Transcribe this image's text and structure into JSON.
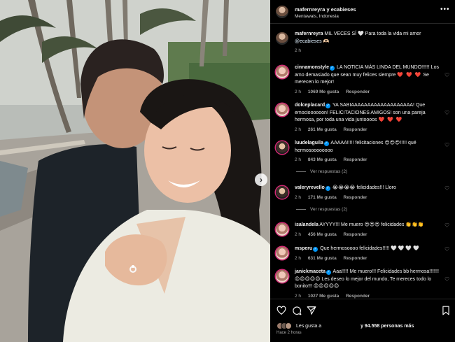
{
  "header": {
    "usernames": "mafernreyra y ecabieses",
    "location": "Mentawais, Indonesia",
    "more_icon": "more-horizontal-icon"
  },
  "caption": {
    "user": "mafernreyra",
    "text_pre": "MIL VECES SÍ 🤍 Para toda la vida mi amor",
    "mention": "@ecabieses",
    "text_post": "🫶🏻",
    "time": "2 h"
  },
  "comments": [
    {
      "user": "cinnamonstyle",
      "verified": true,
      "text": "LA NOTICIA MÁS LINDA DEL MUNDO!!!!!! Los amo demasiado que sean muy felices siempre",
      "hearts": "❤️ ❤️ ❤️",
      "text_after": "Se merecen lo mejor!",
      "time": "2 h",
      "likes": "1069 Me gusta",
      "reply": "Responder"
    },
    {
      "user": "dolceplacard",
      "verified": true,
      "text": "YA SABIAAAAAAAAAAAAAAAAAAA! Que emocioooooon! FELICITACIONES AMIGOS! son una pareja hermosa, por toda una vida juntoooos",
      "hearts": "❤️ ❤️ ❤️",
      "time": "2 h",
      "likes": "261 Me gusta",
      "reply": "Responder"
    },
    {
      "user": "luudelaguila",
      "verified": true,
      "text": "AAAAA!!!!! felicitaciones 😍😍😍!!!!! qué hermosoooooooo",
      "time": "2 h",
      "likes": "843 Me gusta",
      "reply": "Responder",
      "view_replies": "Ver respuestas (2)"
    },
    {
      "user": "valeryrevello",
      "verified": true,
      "text": "😭😭😭😭 felicidades!!! Lloro",
      "time": "2 h",
      "likes": "171 Me gusta",
      "reply": "Responder",
      "view_replies": "Ver respuestas (2)"
    },
    {
      "user": "isalandela",
      "verified": false,
      "text": "AYYYY!!! Me muero 😍😍😍 felicidades 👏👏👏",
      "time": "2 h",
      "likes": "456 Me gusta",
      "reply": "Responder"
    },
    {
      "user": "msperu",
      "verified": true,
      "text": "Que hermosoooo felicidades!!!!!",
      "hearts_white": "🤍 🤍 🤍 🤍",
      "time": "2 h",
      "likes": "631 Me gusta",
      "reply": "Responder"
    },
    {
      "user": "janickmaceta",
      "verified": true,
      "text": "Aaa!!!!! Me muero!!! Felicidades bb hermosa!!!!!!! 😍😍😍😍😍 Les deseo lo mejor del mundo, Te mereces todo lo bonito!!! 😍😍😍😍😍",
      "time": "2 h",
      "likes": "1027 Me gusta",
      "reply": "Responder"
    }
  ],
  "footer": {
    "likes_pre": "Les gusta a",
    "likes_post": "y 94.558 personas más",
    "time_ago": "Hace 2 horas",
    "icons": [
      "heart-icon",
      "comment-icon",
      "share-icon",
      "bookmark-icon"
    ]
  },
  "colors": {
    "background": "#000000",
    "text": "#f5f5f5",
    "muted": "#a8a8a8",
    "verified": "#0095f6",
    "heart": "#ff3040"
  }
}
